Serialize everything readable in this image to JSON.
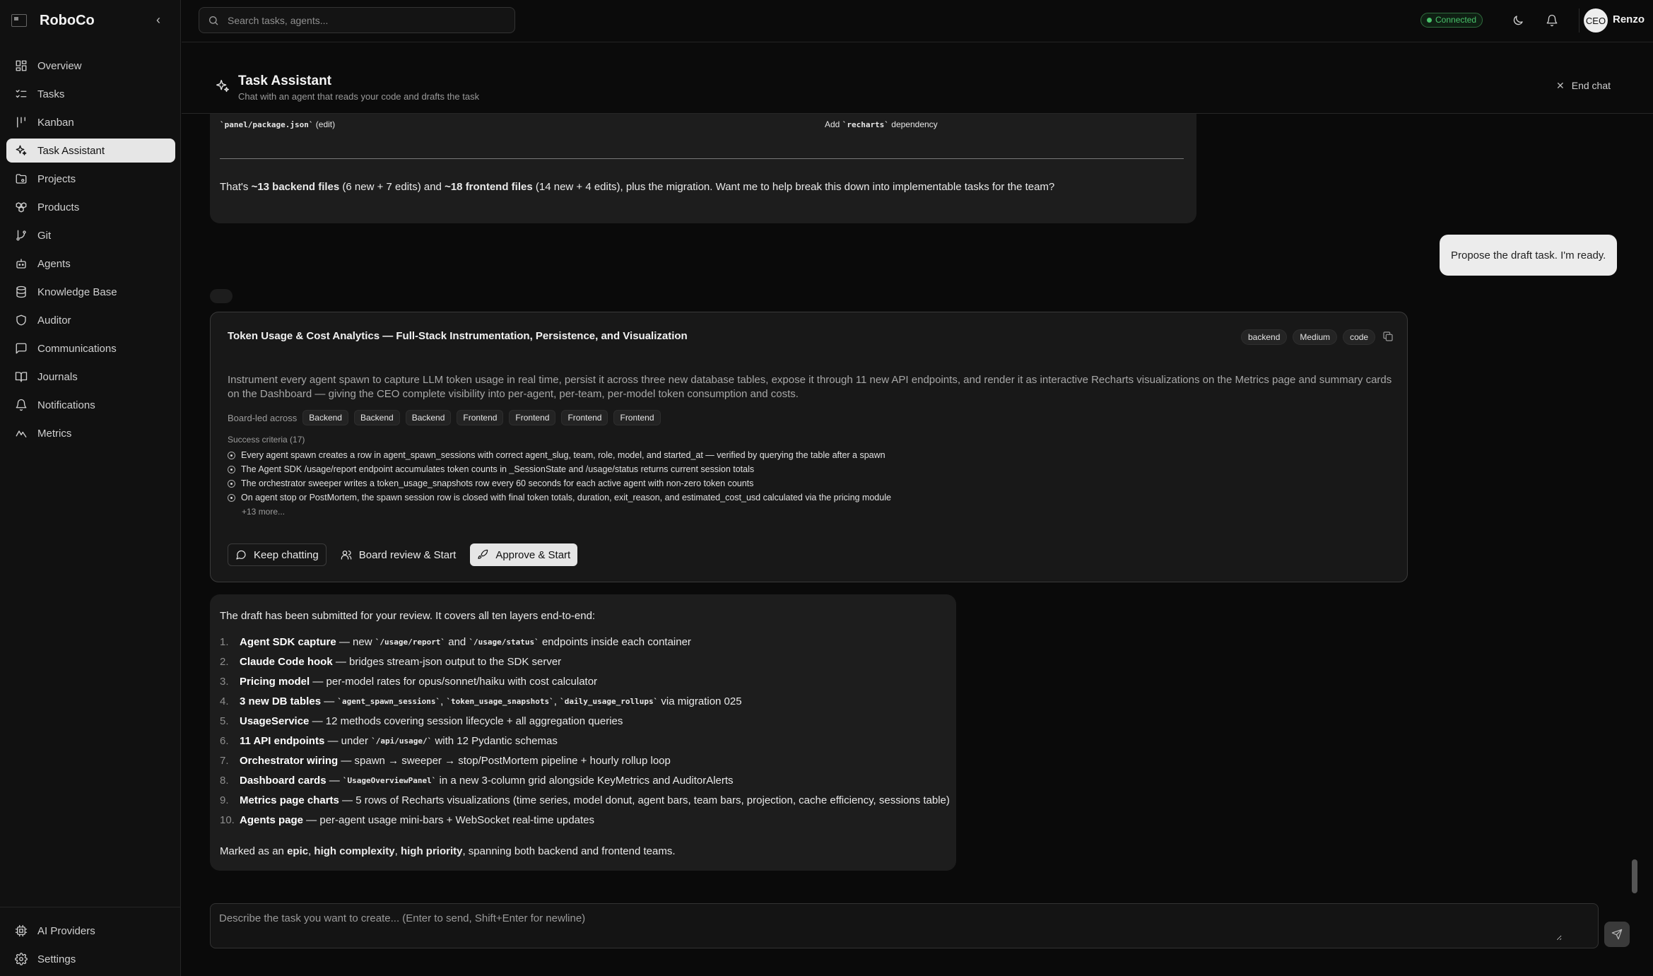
{
  "app": {
    "name": "RoboCo",
    "collapse_icon": "chevron-left-icon"
  },
  "sidebar": {
    "items": [
      {
        "label": "Overview",
        "icon": "grid-icon"
      },
      {
        "label": "Tasks",
        "icon": "list-checks-icon"
      },
      {
        "label": "Kanban",
        "icon": "kanban-icon"
      },
      {
        "label": "Task Assistant",
        "icon": "sparkles-icon",
        "active": true
      },
      {
        "label": "Projects",
        "icon": "folder-icon"
      },
      {
        "label": "Products",
        "icon": "boxes-icon"
      },
      {
        "label": "Git",
        "icon": "git-branch-icon"
      },
      {
        "label": "Agents",
        "icon": "bot-icon"
      },
      {
        "label": "Knowledge Base",
        "icon": "database-icon"
      },
      {
        "label": "Auditor",
        "icon": "shield-icon"
      },
      {
        "label": "Communications",
        "icon": "message-square-icon"
      },
      {
        "label": "Journals",
        "icon": "book-open-icon"
      },
      {
        "label": "Notifications",
        "icon": "bell-icon"
      },
      {
        "label": "Metrics",
        "icon": "activity-icon"
      }
    ],
    "bottom_items": [
      {
        "label": "AI Providers",
        "icon": "cpu-icon"
      },
      {
        "label": "Settings",
        "icon": "gear-icon"
      }
    ]
  },
  "topbar": {
    "search_placeholder": "Search tasks, agents...",
    "connection_status": "Connected",
    "avatar_initials": "CEO",
    "user_name": "Renzo"
  },
  "chat_header": {
    "title": "Task Assistant",
    "subtitle": "Chat with an agent that reads your code and drafts the task",
    "end_chat_label": "End chat"
  },
  "messages": {
    "prev_ai": {
      "file_left_code": "`panel/package.json`",
      "file_left_note": "(edit)",
      "file_right_prefix": "Add",
      "file_right_code": "`recharts`",
      "file_right_suffix": "dependency",
      "summary_pre": "That's",
      "summary_b1": "~13 backend files",
      "summary_mid1": "(6 new + 7 edits) and",
      "summary_b2": "~18 frontend files",
      "summary_post": "(14 new + 4 edits), plus the migration. Want me to help break this down into implementable tasks for the team?"
    },
    "user_message": "Propose the draft task. I'm ready.",
    "draft_card": {
      "title": "Token Usage & Cost Analytics — Full-Stack Instrumentation, Persistence, and Visualization",
      "tags": [
        "backend",
        "Medium",
        "code"
      ],
      "description": "Instrument every agent spawn to capture LLM token usage in real time, persist it across three new database tables, expose it through 11 new API endpoints, and render it as interactive Recharts visualizations on the Metrics page and summary cards on the Dashboard — giving the CEO complete visibility into per-agent, per-team, per-model token consumption and costs.",
      "board_label": "Board-led across",
      "board_members": [
        "Backend",
        "Backend",
        "Backend",
        "Frontend",
        "Frontend",
        "Frontend",
        "Frontend"
      ],
      "criteria_label": "Success criteria (17)",
      "criteria": [
        "Every agent spawn creates a row in agent_spawn_sessions with correct agent_slug, team, role, model, and started_at — verified by querying the table after a spawn",
        "The Agent SDK /usage/report endpoint accumulates token counts in _SessionState and /usage/status returns current session totals",
        "The orchestrator sweeper writes a token_usage_snapshots row every 60 seconds for each active agent with non-zero token counts",
        "On agent stop or PostMortem, the spawn session row is closed with final token totals, duration, exit_reason, and estimated_cost_usd calculated via the pricing module"
      ],
      "criteria_more": "+13 more...",
      "actions": {
        "keep_chatting": "Keep chatting",
        "board_review": "Board review & Start",
        "approve": "Approve & Start"
      }
    },
    "ai_response": {
      "intro": "The draft has been submitted for your review. It covers all ten layers end-to-end:",
      "items": [
        {
          "num": "1.",
          "bold": "Agent SDK capture",
          "parts": [
            " — new ",
            {
              "code": "`/usage/report`"
            },
            " and ",
            {
              "code": "`/usage/status`"
            },
            " endpoints inside each container"
          ]
        },
        {
          "num": "2.",
          "bold": "Claude Code hook",
          "parts": [
            " — bridges stream-json output to the SDK server"
          ]
        },
        {
          "num": "3.",
          "bold": "Pricing model",
          "parts": [
            " — per-model rates for opus/sonnet/haiku with cost calculator"
          ]
        },
        {
          "num": "4.",
          "bold": "3 new DB tables",
          "parts": [
            " — ",
            {
              "code": "`agent_spawn_sessions`"
            },
            ", ",
            {
              "code": "`token_usage_snapshots`"
            },
            ", ",
            {
              "code": "`daily_usage_rollups`"
            },
            " via migration 025"
          ]
        },
        {
          "num": "5.",
          "bold": "UsageService",
          "parts": [
            " — 12 methods covering session lifecycle + all aggregation queries"
          ]
        },
        {
          "num": "6.",
          "bold": "11 API endpoints",
          "parts": [
            " — under ",
            {
              "code": "`/api/usage/`"
            },
            " with 12 Pydantic schemas"
          ]
        },
        {
          "num": "7.",
          "bold": "Orchestrator wiring",
          "parts": [
            " — spawn → sweeper → stop/PostMortem pipeline + hourly rollup loop"
          ]
        },
        {
          "num": "8.",
          "bold": "Dashboard cards",
          "parts": [
            " — ",
            {
              "code": "`UsageOverviewPanel`"
            },
            " in a new 3-column grid alongside KeyMetrics and AuditorAlerts"
          ]
        },
        {
          "num": "9.",
          "bold": "Metrics page charts",
          "parts": [
            " — 5 rows of Recharts visualizations (time series, model donut, agent bars, team bars, projection, cache efficiency, sessions table)"
          ]
        },
        {
          "num": "10.",
          "bold": "Agents page",
          "parts": [
            " — per-agent usage mini-bars + WebSocket real-time updates"
          ]
        }
      ],
      "footer_pre": "Marked as an",
      "footer_b1": "epic",
      "footer_sep1": ",",
      "footer_b2": "high complexity",
      "footer_sep2": ",",
      "footer_b3": "high priority",
      "footer_post": ", spanning both backend and frontend teams."
    }
  },
  "composer": {
    "placeholder": "Describe the task you want to create... (Enter to send, Shift+Enter for newline)",
    "send_icon": "send-icon"
  },
  "colors": {
    "accent_connected": "#49c26a",
    "active_nav_bg": "#e6e6e6",
    "bubble_bg": "#1d1d1d"
  }
}
